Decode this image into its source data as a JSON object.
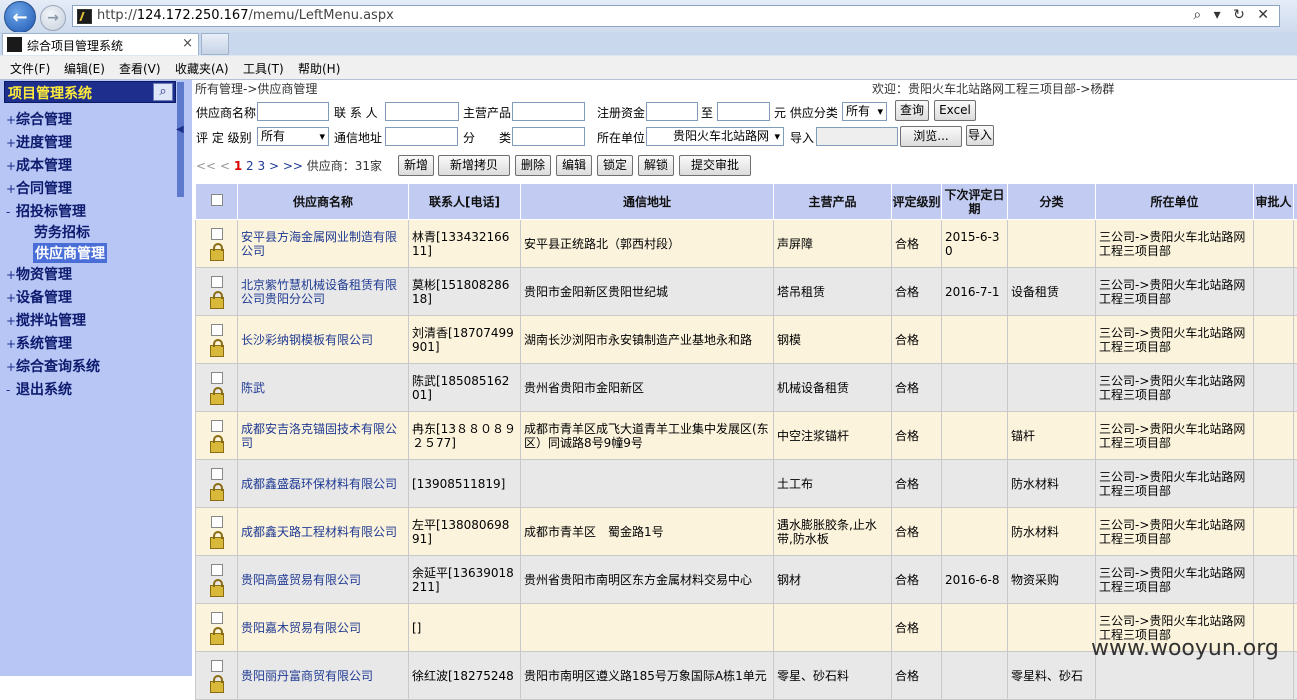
{
  "browser": {
    "url_prefix": "http://",
    "url_host": "124.172.250.167",
    "url_path": "/memu/LeftMenu.aspx",
    "tab_title": "综合项目管理系统",
    "tab_close": "×",
    "url_controls": "⌕ ▾ ↻ ✕",
    "menu": [
      "文件(F)",
      "编辑(E)",
      "查看(V)",
      "收藏夹(A)",
      "工具(T)",
      "帮助(H)"
    ]
  },
  "sidebar": {
    "title": "项目管理系统",
    "items": [
      {
        "label": "综合管理",
        "marker": "+"
      },
      {
        "label": "进度管理",
        "marker": "+"
      },
      {
        "label": "成本管理",
        "marker": "+"
      },
      {
        "label": "合同管理",
        "marker": "+"
      },
      {
        "label": "招投标管理",
        "marker": "-"
      },
      {
        "label": "劳务招标",
        "marker": ""
      },
      {
        "label": "供应商管理",
        "marker": ""
      },
      {
        "label": "物资管理",
        "marker": "+"
      },
      {
        "label": "设备管理",
        "marker": "+"
      },
      {
        "label": "搅拌站管理",
        "marker": "+"
      },
      {
        "label": "系统管理",
        "marker": "+"
      },
      {
        "label": "综合查询系统",
        "marker": "+"
      },
      {
        "label": "退出系统",
        "marker": "-"
      }
    ]
  },
  "breadcrumb": "所有管理->供应商管理",
  "welcome": "欢迎：贵阳火车北站路网工程三项目部->杨群",
  "search": {
    "supplier_name_label": "供应商名称",
    "contact_label": "联 系 人",
    "product_label": "主营产品",
    "capital_label": "注册资金",
    "to_label": "至",
    "unit_label": "元 供应分类",
    "category_value": "所有",
    "query_button": "查询",
    "excel_button": "Excel",
    "grade_label": "评 定 级别",
    "grade_value": "所有",
    "address_label": "通信地址",
    "class_label": "分　　类",
    "org_label": "所在单位",
    "org_value": "贵阳火车北站路网",
    "import_label": "导入",
    "browse_button": "浏览...",
    "import_button": "导入"
  },
  "pager": {
    "first": "<<",
    "prev": "<",
    "current": "1",
    "pages": [
      "2",
      "3"
    ],
    "next": ">",
    "last": ">>",
    "count_label": "供应商：31家"
  },
  "actions": [
    "新增",
    "新增拷贝",
    "删除",
    "编辑",
    "锁定",
    "解锁",
    "提交审批"
  ],
  "table": {
    "headers": [
      "供应商名称",
      "联系人[电话]",
      "通信地址",
      "主营产品",
      "评定级别",
      "下次评定日期",
      "分类",
      "所在单位",
      "审批人"
    ],
    "rows": [
      {
        "name": "安平县方海金属网业制造有限公司",
        "contact": "林青[13343216611]",
        "address": "安平县正统路北（郭西村段）",
        "product": "声屏障",
        "grade": "合格",
        "next": "2015-6-30",
        "category": "",
        "org": "三公司->贵阳火车北站路网工程三项目部",
        "approver": ""
      },
      {
        "name": "北京紫竹慧机械设备租赁有限公司贵阳分公司",
        "contact": "莫彬[15180828618]",
        "address": "贵阳市金阳新区贵阳世纪城",
        "product": "塔吊租赁",
        "grade": "合格",
        "next": "2016-7-1",
        "category": "设备租赁",
        "org": "三公司->贵阳火车北站路网工程三项目部",
        "approver": ""
      },
      {
        "name": "长沙彩纳钢模板有限公司",
        "contact": "刘清香[18707499901]",
        "address": "湖南长沙浏阳市永安镇制造产业基地永和路",
        "product": "钢模",
        "grade": "合格",
        "next": "",
        "category": "",
        "org": "三公司->贵阳火车北站路网工程三项目部",
        "approver": ""
      },
      {
        "name": "陈武",
        "contact": "陈武[18508516201]",
        "address": "贵州省贵阳市金阳新区",
        "product": "机械设备租赁",
        "grade": "合格",
        "next": "",
        "category": "",
        "org": "三公司->贵阳火车北站路网工程三项目部",
        "approver": ""
      },
      {
        "name": "成都安吉洛克锚固技术有限公司",
        "contact": "冉东[13８８０８９２５77]",
        "address": "成都市青羊区成飞大道青羊工业集中发展区(东区）同诚路8号9幢9号",
        "product": "中空注浆锚杆",
        "grade": "合格",
        "next": "",
        "category": "锚杆",
        "org": "三公司->贵阳火车北站路网工程三项目部",
        "approver": ""
      },
      {
        "name": "成都鑫盛磊环保材料有限公司",
        "contact": "[13908511819]",
        "address": "",
        "product": "土工布",
        "grade": "合格",
        "next": "",
        "category": "防水材料",
        "org": "三公司->贵阳火车北站路网工程三项目部",
        "approver": ""
      },
      {
        "name": "成都鑫天路工程材料有限公司",
        "contact": "左平[13808069891]",
        "address": "成都市青羊区　蜀金路1号",
        "product": "遇水膨胀胶条,止水带,防水板",
        "grade": "合格",
        "next": "",
        "category": "防水材料",
        "org": "三公司->贵阳火车北站路网工程三项目部",
        "approver": ""
      },
      {
        "name": "贵阳高盛贸易有限公司",
        "contact": "余延平[13639018211]",
        "address": "贵州省贵阳市南明区东方金属材料交易中心",
        "product": "钢材",
        "grade": "合格",
        "next": "2016-6-8",
        "category": "物资采购",
        "org": "三公司->贵阳火车北站路网工程三项目部",
        "approver": ""
      },
      {
        "name": "贵阳嘉木贸易有限公司",
        "contact": "[]",
        "address": "",
        "product": "",
        "grade": "合格",
        "next": "",
        "category": "",
        "org": "三公司->贵阳火车北站路网工程三项目部",
        "approver": ""
      },
      {
        "name": "贵阳丽丹富商贸有限公司",
        "contact": "徐红波[18275248",
        "address": "贵阳市南明区遵义路185号万象国际A栋1单元",
        "product": "零星、砂石料",
        "grade": "合格",
        "next": "",
        "category": "零星料、砂石",
        "org": "",
        "approver": ""
      }
    ]
  },
  "watermark": "www.wooyun.org"
}
